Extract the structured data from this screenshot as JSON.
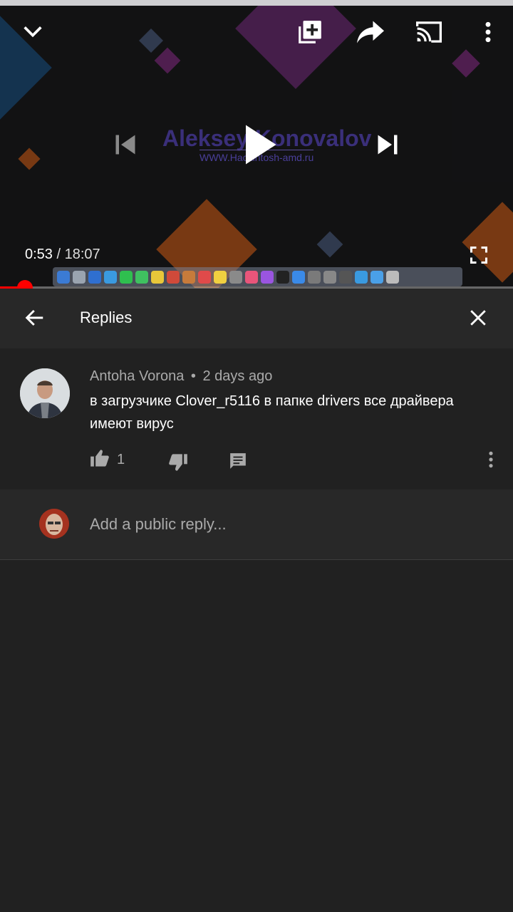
{
  "player": {
    "watermark_title": "Aleksey Konovalov",
    "watermark_url": "WWW.Hackintosh-amd.ru",
    "current_time": "0:53",
    "duration": "18:07",
    "progress_fraction": 0.049,
    "icons": {
      "collapse": "chevron-down-icon",
      "add_to_playlist": "playlist-add-icon",
      "share": "share-icon",
      "cast": "cast-icon",
      "more": "more-vert-icon",
      "previous": "skip-previous-icon",
      "play": "play-icon",
      "next": "skip-next-icon",
      "fullscreen": "fullscreen-icon"
    },
    "accent_color": "#ff0000"
  },
  "replies_panel": {
    "title": "Replies",
    "icons": {
      "back": "arrow-back-icon",
      "close": "close-icon"
    }
  },
  "comment": {
    "author": "Antoha Vorona",
    "separator": "•",
    "time_ago": "2 days ago",
    "text": "в загрузчике Clover_r5116 в папке drivers все драйвера имеют вирус",
    "like_count": "1",
    "icons": {
      "like": "thumb-up-icon",
      "dislike": "thumb-down-icon",
      "reply": "comment-icon",
      "more": "more-vert-icon"
    }
  },
  "reply_box": {
    "placeholder": "Add a public reply..."
  }
}
